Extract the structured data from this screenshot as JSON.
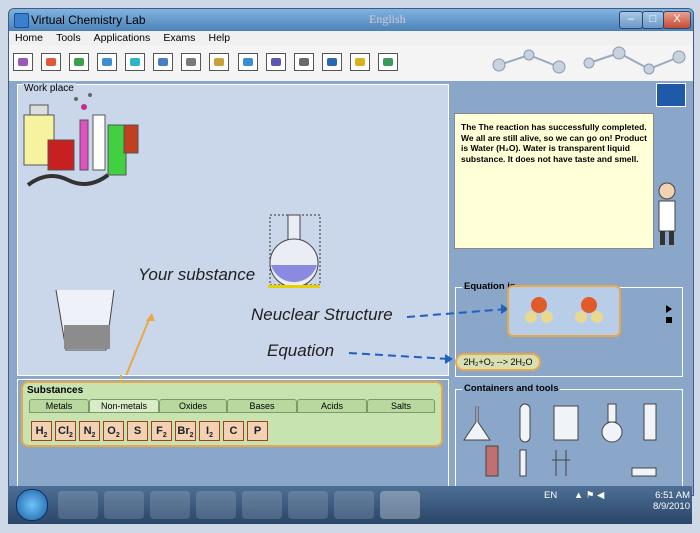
{
  "window": {
    "title": "Virtual Chemistry Lab",
    "language": "English",
    "min_label": "–",
    "max_label": "□",
    "close_label": "X"
  },
  "menu": [
    "Home",
    "Tools",
    "Applications",
    "Exams",
    "Help"
  ],
  "workplace": {
    "label": "Work place",
    "your_substance": "Your substance"
  },
  "annotations": {
    "neuclear_structure": "Neuclear Structure",
    "equation": "Equation"
  },
  "message": "The The reaction has successfully completed. We all are still alive, so we can go on! Product is Water (H₂O). Water is transparent liquid substance. It does not have taste and smell.",
  "equation_panel": {
    "label": "Equation in",
    "equation": "2H₂+O₂ --> 2H₂O"
  },
  "substances": {
    "label": "Substances",
    "tabs": [
      "Metals",
      "Non-metals",
      "Oxides",
      "Bases",
      "Acids",
      "Salts"
    ],
    "selected_tab": "Non-metals",
    "elements": [
      {
        "symbol": "H",
        "sub": "2"
      },
      {
        "symbol": "Cl",
        "sub": "2"
      },
      {
        "symbol": "N",
        "sub": "2"
      },
      {
        "symbol": "O",
        "sub": "2"
      },
      {
        "symbol": "S",
        "sub": ""
      },
      {
        "symbol": "F",
        "sub": "2"
      },
      {
        "symbol": "Br",
        "sub": "2"
      },
      {
        "symbol": "I",
        "sub": "2"
      },
      {
        "symbol": "C",
        "sub": ""
      },
      {
        "symbol": "P",
        "sub": ""
      }
    ]
  },
  "containers": {
    "label": "Containers and tools"
  },
  "taskbar": {
    "lang": "EN",
    "time": "6:51 AM",
    "date": "8/9/2010"
  }
}
